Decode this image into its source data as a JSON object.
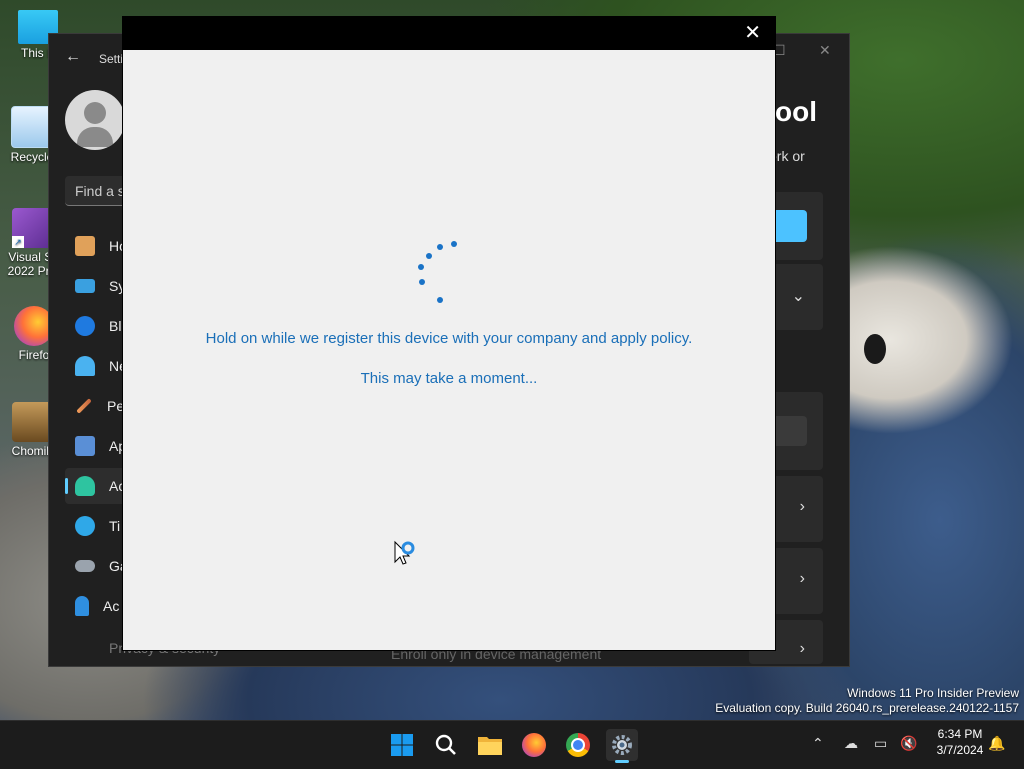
{
  "desktop": {
    "icons": [
      {
        "label": "This P"
      },
      {
        "label": "Recycle"
      },
      {
        "label": "Visual St\n2022 Pre"
      },
      {
        "label": "Firefo"
      },
      {
        "label": "Chomik"
      }
    ]
  },
  "settings_window": {
    "title": "Setti",
    "search_placeholder": "Find a s",
    "nav_items": [
      {
        "label": "Ho",
        "icon": "home-icon"
      },
      {
        "label": "Sy",
        "icon": "system-icon"
      },
      {
        "label": "Bl",
        "icon": "bluetooth-icon"
      },
      {
        "label": "Ne",
        "icon": "network-icon"
      },
      {
        "label": "Pe",
        "icon": "personalization-icon"
      },
      {
        "label": "Ap",
        "icon": "apps-icon"
      },
      {
        "label": "Ac",
        "icon": "accounts-icon"
      },
      {
        "label": "Ti",
        "icon": "time-icon"
      },
      {
        "label": "Ga",
        "icon": "gaming-icon"
      },
      {
        "label": "Ac",
        "icon": "accessibility-icon"
      }
    ],
    "privacy_label": "Privacy & security",
    "heading_fragment": "ool",
    "subtitle_fragment": "ork or",
    "enroll_text": "Enroll only in device management"
  },
  "dialog": {
    "message": "Hold on while we register this device with your company and apply policy.",
    "submessage": "This may take a moment...",
    "close_glyph": "✕"
  },
  "watermark": {
    "line1": "Windows 11 Pro Insider Preview",
    "line2": "Evaluation copy. Build 26040.rs_prerelease.240122-1157"
  },
  "taskbar": {
    "apps": [
      "start-icon",
      "search-icon",
      "file-explorer-icon",
      "firefox-icon",
      "chrome-icon",
      "settings-icon"
    ],
    "active_app": "settings-icon",
    "time": "6:34 PM",
    "date": "3/7/2024"
  },
  "colors": {
    "accent": "#60cdff",
    "dialog_text": "#1a6fb8",
    "spinner": "#1a73c7"
  }
}
